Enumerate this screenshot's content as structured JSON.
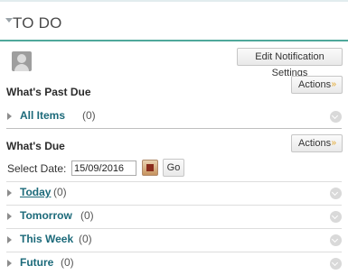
{
  "header": {
    "title": "TO DO"
  },
  "toolbar": {
    "notification_button": "Edit Notification Settings"
  },
  "past_due": {
    "title": "What's Past Due",
    "actions_label": "Actions",
    "items": [
      {
        "label": "All Items",
        "count": "(0)"
      }
    ]
  },
  "due": {
    "title": "What's Due",
    "actions_label": "Actions",
    "select_date_label": "Select Date:",
    "date_value": "15/09/2016",
    "go_label": "Go",
    "items": [
      {
        "label": "Today",
        "count": "(0)"
      },
      {
        "label": "Tomorrow",
        "count": "(0)"
      },
      {
        "label": "This Week",
        "count": "(0)"
      },
      {
        "label": "Future",
        "count": "(0)"
      }
    ]
  },
  "icons": {
    "collapse": "triangle-down-icon",
    "expand": "triangle-right-icon",
    "status": "circle-chevron-icon",
    "calendar": "calendar-icon",
    "avatar": "user-avatar-icon"
  },
  "colors": {
    "accent_line": "#4fa89b",
    "link": "#1c6a7a",
    "actions_chevron": "#e3a424"
  }
}
